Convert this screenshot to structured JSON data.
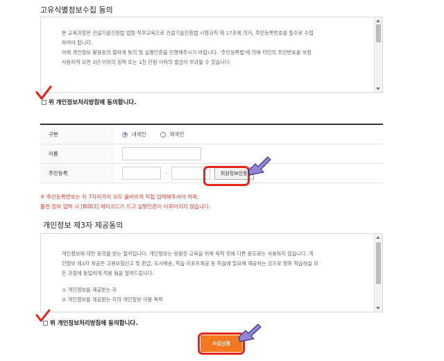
{
  "section1": {
    "title": "고유식별정보수집 동의",
    "body": [
      "본 교육과정은 건설기술진흥법 법정 직무교육으로 건설기술진흥법 시행규칙 제 17조에 의거, 주민등록번호를 필수로 수집",
      "하여야 합니다.",
      "아래 개인정보 활용동의 절차에 동의 및 실명인증을 진행해주시기 바랍니다. '주민등록법'에 의해 타인의 주민번호를 부정",
      "사용하게 되면 3년 이하의 징역 또는 1천 만원 이하의 벌금이 부과될 수 있습니다."
    ],
    "agree_label": "위 개인정보처리방침에 동의합니다."
  },
  "form": {
    "nationality_label": "구분",
    "nationality_options": [
      "내국인",
      "외국인"
    ],
    "nationality_selected": "내국인",
    "name_label": "이름",
    "name_value": "",
    "rrn_label": "주민등록",
    "rrn_separator": "-",
    "verify_button": "회원정보인증"
  },
  "notice": [
    "※ 주민등록번호는 뒤 7자리까지 모두 올바르게 직접 입력해주셔야 하며,",
    "틀린 정보 입력 시 [B003] 에러코드가 뜨고 실명인증이 이루어지지 않습니다."
  ],
  "section2": {
    "title": "개인정보 제3자 제공동의",
    "body": [
      "개인정보에 대한 동의를 받는 절차입니다. 개인정보는 원활한 교육을 위해 목적 외에 다른 용도로는 사용하지 않습니다. 게",
      "인정보 제3자 제공은 고용보험신고 및 환급, 도서배송, 학습 리포트제공 등 학습에 필요해 제공하는 것으로 향후 학습하실 모",
      "든 과정에 동일하게 적용 됨을 알려드립니다.",
      "",
      "① 개인정보를 제공받는 자",
      "② 개인정보를 제공받는 자의 개인정보 이용 목적"
    ],
    "agree_label": "위 개인정보처리방침에 동의합니다."
  },
  "submit_button": "수강신청",
  "colors": {
    "accent_red": "#e5241a",
    "submit_orange": "#f4781f",
    "arrow_purple": "#8f86d8"
  }
}
